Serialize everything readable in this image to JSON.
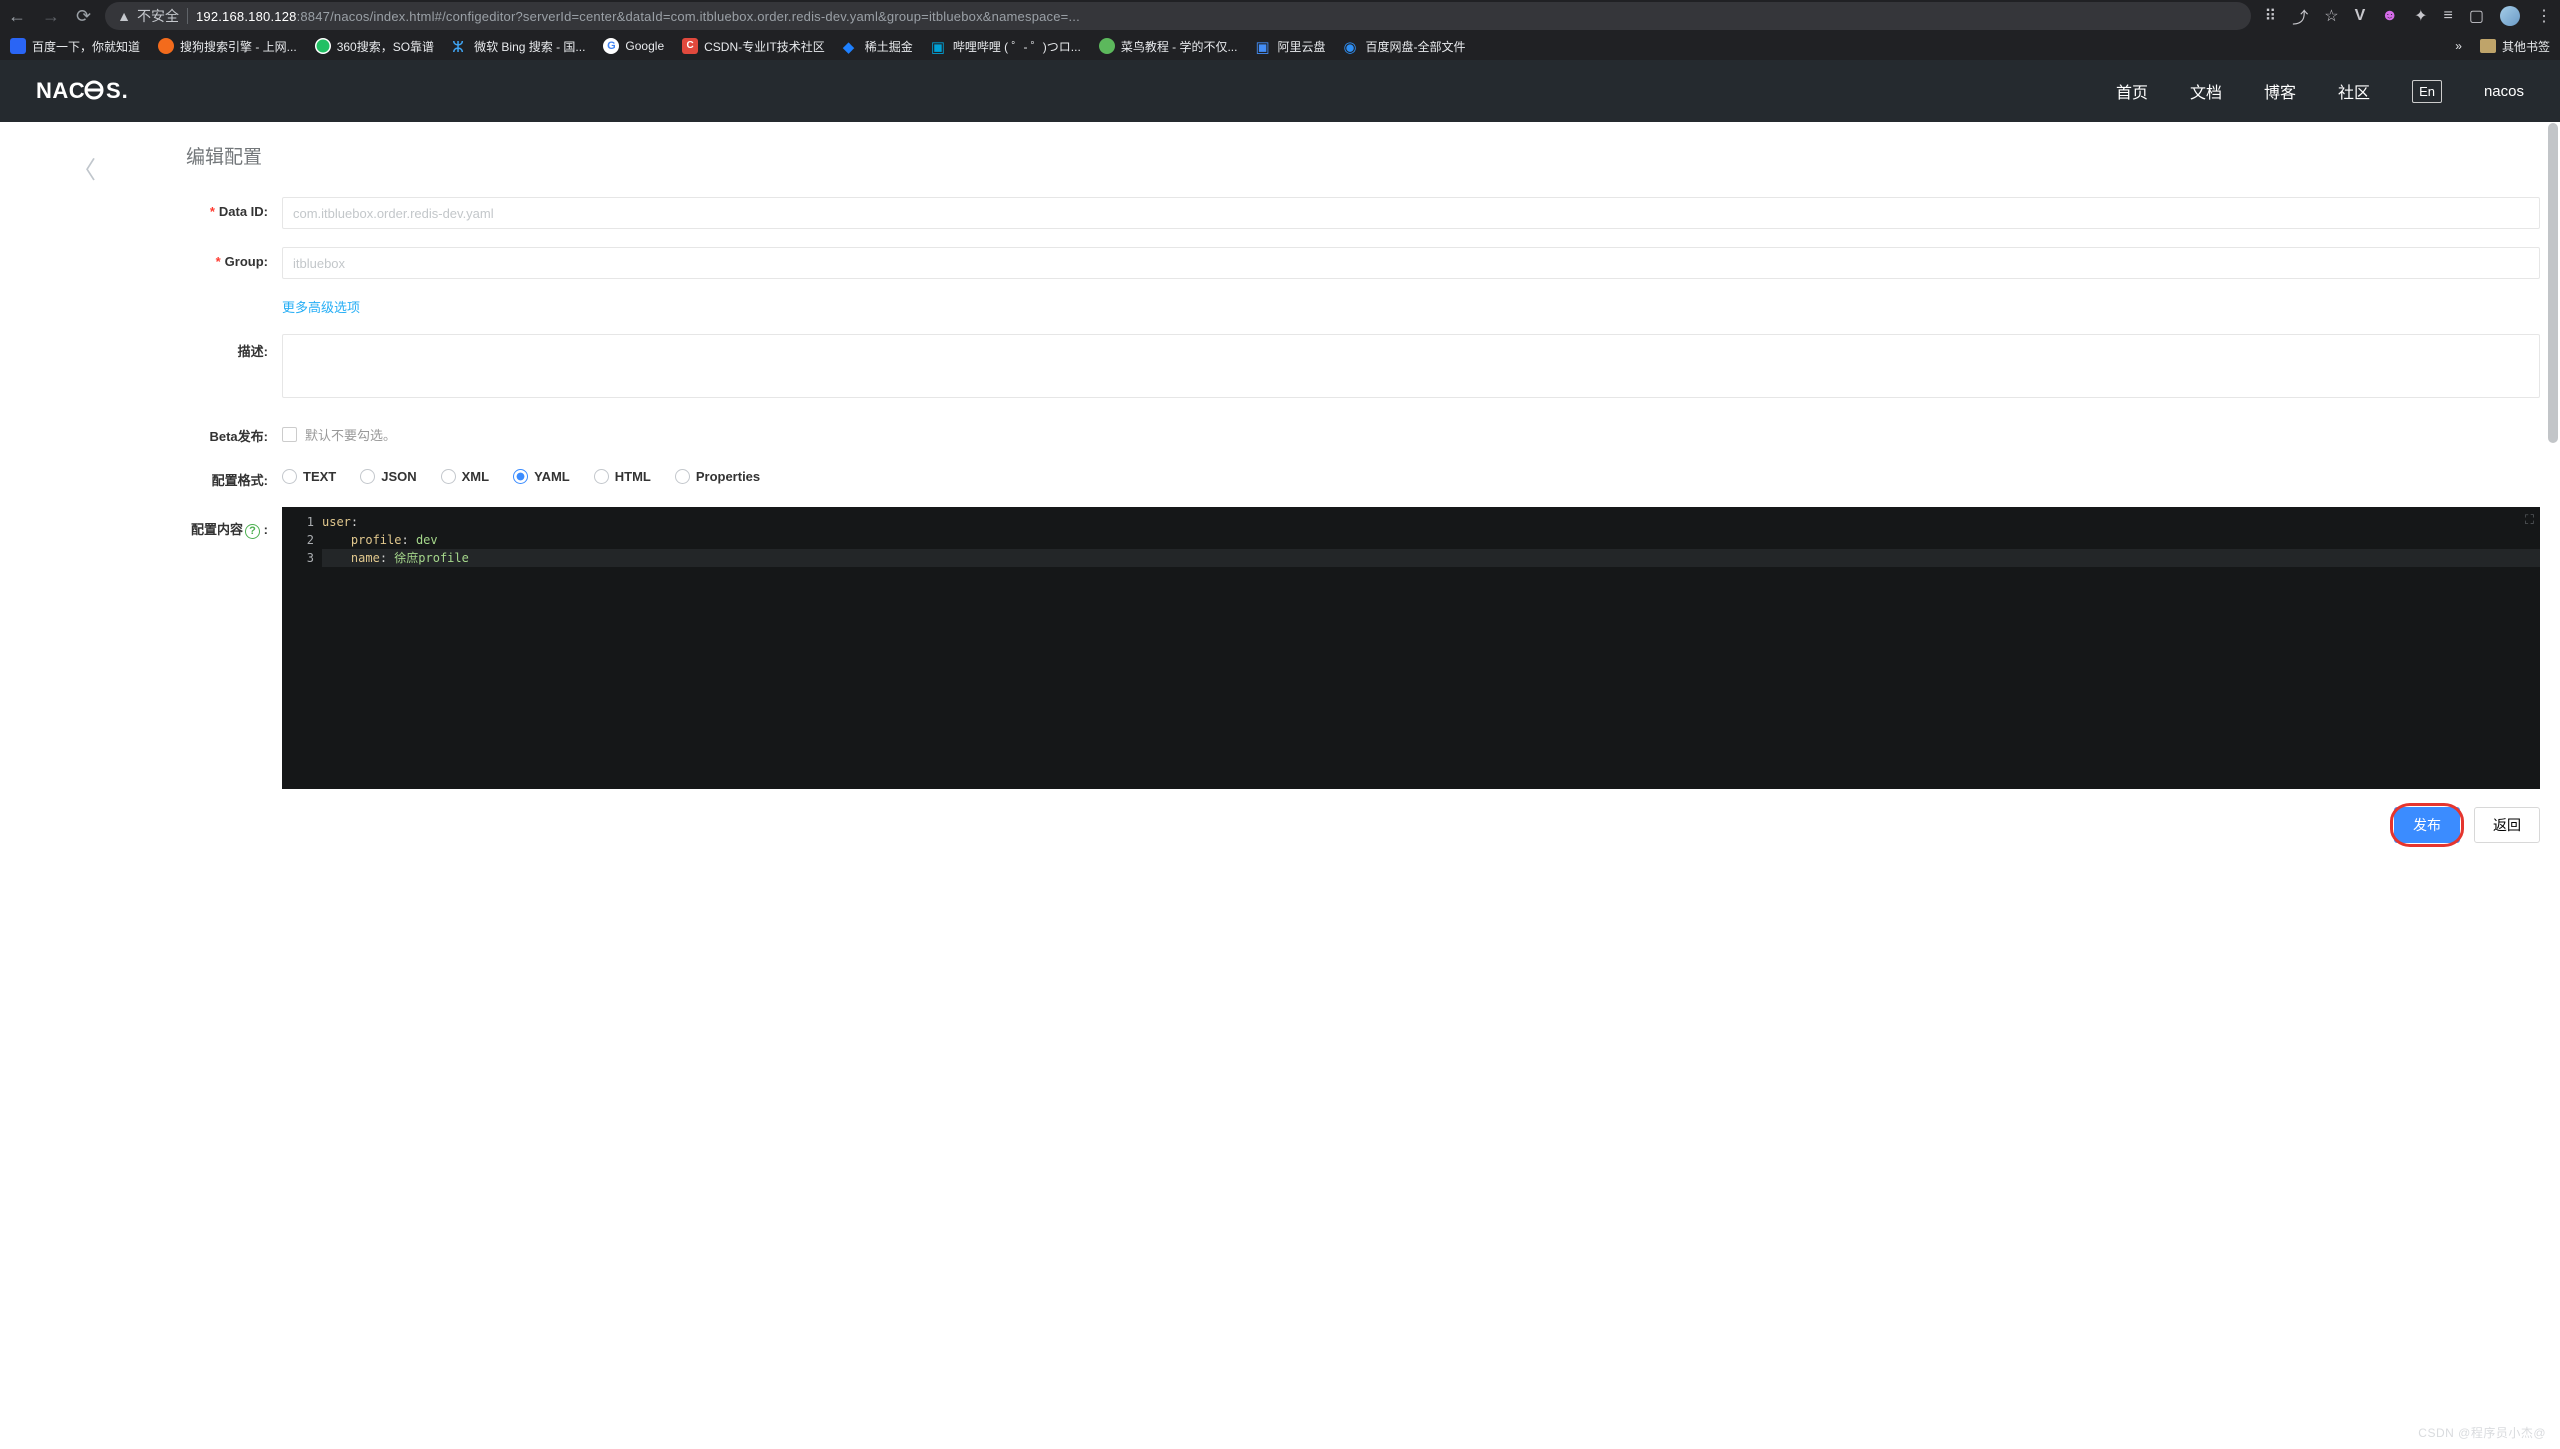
{
  "browser": {
    "security_label": "不安全",
    "url_host": "192.168.180.128",
    "url_rest": ":8847/nacos/index.html#/configeditor?serverId=center&dataId=com.itbluebox.order.redis-dev.yaml&group=itbluebox&namespace=...",
    "bookmarks": [
      {
        "label": "百度一下，你就知道"
      },
      {
        "label": "搜狗搜索引擎 - 上网..."
      },
      {
        "label": "360搜索，SO靠谱"
      },
      {
        "label": "微软 Bing 搜索 - 国..."
      },
      {
        "label": "Google"
      },
      {
        "label": "CSDN-专业IT技术社区"
      },
      {
        "label": "稀土掘金"
      },
      {
        "label": "哔哩哔哩 (  ゜- ゜)つロ..."
      },
      {
        "label": "菜鸟教程 - 学的不仅..."
      },
      {
        "label": "阿里云盘"
      },
      {
        "label": "百度网盘-全部文件"
      }
    ],
    "other_bookmarks": "其他书签"
  },
  "header": {
    "logo": "NACOS.",
    "nav": [
      "首页",
      "文档",
      "博客",
      "社区"
    ],
    "lang": "En",
    "user": "nacos"
  },
  "page": {
    "title": "编辑配置",
    "labels": {
      "data_id": "Data ID:",
      "group": "Group:",
      "desc": "描述:",
      "beta": "Beta发布:",
      "format": "配置格式:",
      "content": "配置内容"
    },
    "advanced": "更多高级选项",
    "fields": {
      "data_id": "com.itbluebox.order.redis-dev.yaml",
      "group": "itbluebox",
      "beta_hint": "默认不要勾选。"
    },
    "formats": [
      "TEXT",
      "JSON",
      "XML",
      "YAML",
      "HTML",
      "Properties"
    ],
    "format_selected": "YAML",
    "code": {
      "lines": [
        {
          "n": "1",
          "k": "user",
          "v": ""
        },
        {
          "n": "2",
          "k": "profile",
          "v": "dev",
          "indent": 1
        },
        {
          "n": "3",
          "k": "name",
          "v": "徐庶profile",
          "indent": 1,
          "hl": true
        }
      ]
    },
    "buttons": {
      "publish": "发布",
      "back": "返回"
    },
    "watermark": "CSDN @程序员小杰@"
  }
}
